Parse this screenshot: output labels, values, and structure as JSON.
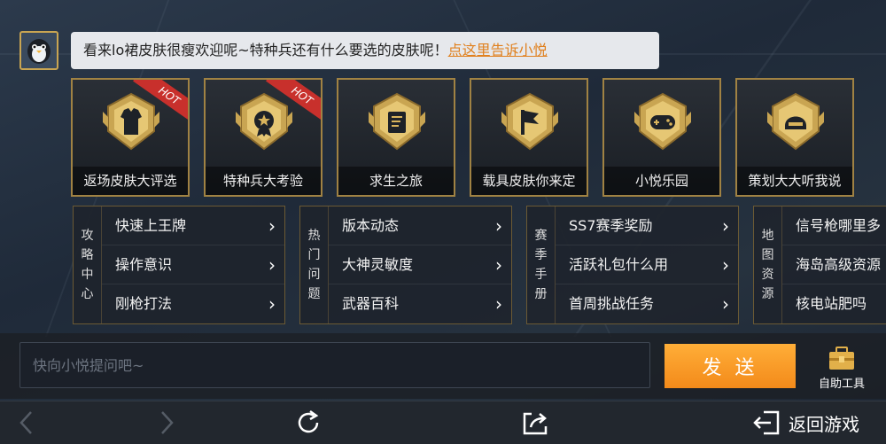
{
  "chat": {
    "avatar_icon": "penguin-avatar-icon",
    "message": "看来lo裙皮肤很瘦欢迎呢~特种兵还有什么要选的皮肤呢！",
    "link_text": "点这里告诉小悦"
  },
  "cards": [
    {
      "label": "返场皮肤大评选",
      "icon": "jacket-emblem-icon",
      "hot": "HOT"
    },
    {
      "label": "特种兵大考验",
      "icon": "medal-emblem-icon",
      "hot": "HOT"
    },
    {
      "label": "求生之旅",
      "icon": "map-emblem-icon",
      "hot": ""
    },
    {
      "label": "载具皮肤你来定",
      "icon": "flag-emblem-icon",
      "hot": ""
    },
    {
      "label": "小悦乐园",
      "icon": "gamepad-emblem-icon",
      "hot": ""
    },
    {
      "label": "策划大大听我说",
      "icon": "helmet-emblem-icon",
      "hot": ""
    }
  ],
  "panels": [
    {
      "side": [
        "攻",
        "略",
        "中",
        "心"
      ],
      "items": [
        "快速上王牌",
        "操作意识",
        "刚枪打法"
      ]
    },
    {
      "side": [
        "热",
        "门",
        "问",
        "题"
      ],
      "items": [
        "版本动态",
        "大神灵敏度",
        "武器百科"
      ]
    },
    {
      "side": [
        "赛",
        "季",
        "手",
        "册"
      ],
      "items": [
        "SS7赛季奖励",
        "活跃礼包什么用",
        "首周挑战任务"
      ]
    },
    {
      "side": [
        "地",
        "图",
        "资",
        "源"
      ],
      "items": [
        "信号枪哪里多",
        "海岛高级资源",
        "核电站肥吗"
      ]
    }
  ],
  "input": {
    "placeholder": "快向小悦提问吧~",
    "value": ""
  },
  "send_label": "发 送",
  "tools_label": "自助工具",
  "nav": {
    "back_game_label": "返回游戏"
  },
  "colors": {
    "accent": "#f7a02c",
    "gold": "#c9a552",
    "link": "#e0801e",
    "hot": "#c8302c"
  }
}
